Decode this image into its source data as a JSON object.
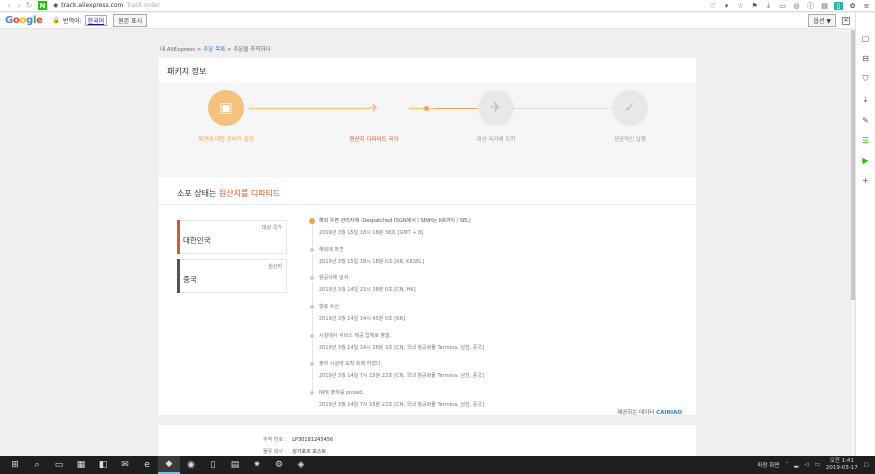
{
  "browser": {
    "url_host": "track.aliexpress.com",
    "tab_title": "Track order"
  },
  "translate": {
    "logo": [
      "G",
      "o",
      "o",
      "g",
      "l",
      "e"
    ],
    "label": "번역어:",
    "language": "한국어",
    "show_original": "원본 표시",
    "options": "옵션 ▼",
    "close": "✕"
  },
  "breadcrumb": {
    "home": "내 AliExpress",
    "sep1": " > ",
    "orders": "주문 목록",
    "sep2": " > ",
    "current": "주문을 추적하다"
  },
  "card": {
    "title": "패키지 정보",
    "steps": [
      {
        "label": "파견에 대한 준비가 출하",
        "icon": "▣"
      },
      {
        "label": "원산지 디파티드 국가",
        "icon": "✈"
      },
      {
        "label": "대상 국가에 도착",
        "icon": "✈"
      },
      {
        "label": "성공적인 납품",
        "icon": "✓"
      }
    ],
    "status_prefix": "소포 상태는 ",
    "status_highlight": "원산지를 디파티드",
    "destination": {
      "tag": "대상 국가",
      "name": "대한민국"
    },
    "origin": {
      "tag": "원산지",
      "name": "중국"
    },
    "events": [
      {
        "msg": "해외 우편 관리자께 -Despatched (SGN에서 / SINH는 KR까지 / SEL)",
        "time": "2019년 3월 15일 18시 18분 38초 [GMT + 8]"
      },
      {
        "msg": "해외에 파견",
        "time": "2019년 3월 15일 18시 18분 0초 [KR, KRSEL]"
      },
      {
        "msg": "항공사에 넘겨.",
        "time": "2019년 3월 14일 23시 38분 0초 [CN, HK]"
      },
      {
        "msg": "항로 수신",
        "time": "2019년 3월 14일 14시 45분 0초 [KR]"
      },
      {
        "msg": "시설에서 서비스 제공 업체로 출발.",
        "time": "2019년 3월 14일 14시 28분 3초 [CN, 국내 항공화물 Termina, 심천, 중국]"
      },
      {
        "msg": "출하 시설에 도착 트랙 하였다.",
        "time": "2019년 3월 14일 7시 15분 22초 [CN, 국내 항공화물 Termina, 심천, 중국]"
      },
      {
        "msg": "NPK 출하를 picked.",
        "time": "2019년 3월 14일 7시 15분 22초 [CN, 국내 항공화물 Termina, 심천, 중국]"
      }
    ],
    "provider_prefix": "제공하는 데이터 ",
    "provider_brand": "CAINIAO"
  },
  "shipment": {
    "tracking_label": "추적 번호 :",
    "tracking_value": "LP30181245456",
    "carrier_label": "물류 회사 :",
    "carrier_value": "싱가포르 포스트"
  },
  "taskbar": {
    "ime": "파랑 화면",
    "time": "오전 1:41",
    "date": "2019-03-17"
  },
  "colors": {
    "accent": "#f0a24c",
    "highlight": "#e0532f",
    "link": "#2a7fd4"
  }
}
